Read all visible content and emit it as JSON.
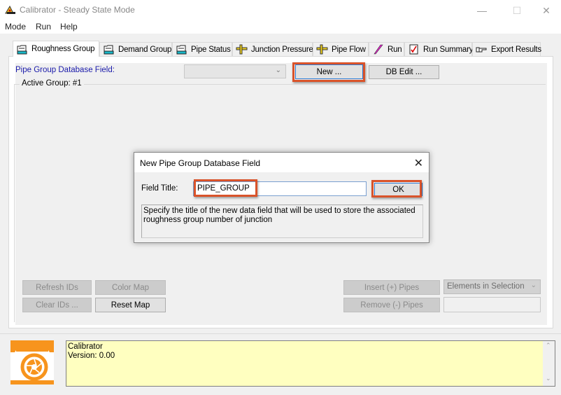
{
  "window": {
    "title": "Calibrator - Steady State Mode",
    "controls": {
      "minimize": "—",
      "maximize": "☐",
      "close": "✕"
    }
  },
  "menu": [
    "Mode",
    "Run",
    "Help"
  ],
  "tabs": [
    {
      "label": "Roughness Group",
      "icon": "folder-icon",
      "active": true
    },
    {
      "label": "Demand Group",
      "icon": "folder-icon",
      "active": false
    },
    {
      "label": "Pipe Status",
      "icon": "folder-icon",
      "active": false
    },
    {
      "label": "Junction Pressure",
      "icon": "ruler-icon",
      "active": false
    },
    {
      "label": "Pipe Flow",
      "icon": "ruler-icon",
      "active": false
    },
    {
      "label": "Run",
      "icon": "lightning-icon",
      "active": false
    },
    {
      "label": "Run Summary",
      "icon": "checklist-icon",
      "active": false
    },
    {
      "label": "Export Results",
      "icon": "pointing-hand-icon",
      "active": false
    }
  ],
  "roughness": {
    "db_field_label": "Pipe Group Database Field:",
    "db_field_value": "",
    "new_button": "New ...",
    "db_edit_button": "DB Edit ...",
    "active_group_label": "Active Group: #1",
    "refresh_ids": "Refresh IDs",
    "color_map": "Color Map",
    "clear_ids": "Clear IDs ...",
    "reset_map": "Reset Map",
    "insert_pipes": "Insert (+) Pipes",
    "remove_pipes": "Remove (-) Pipes",
    "selection_combo": "Elements in Selection",
    "selection_input": ""
  },
  "dialog": {
    "title": "New Pipe Group Database Field",
    "close": "✕",
    "field_label": "Field Title:",
    "field_value": "PIPE_GROUP",
    "ok_button": "OK",
    "description": "Specify the title of the new data field that will be used to store the associated roughness group number of junction"
  },
  "info_panel": {
    "line1": "Calibrator",
    "line2": "Version: 0.00"
  },
  "colors": {
    "highlight": "#d9532a",
    "info_bg": "#ffffc0",
    "logo_orange": "#f7941d",
    "label_blue": "#1a1aaa"
  }
}
